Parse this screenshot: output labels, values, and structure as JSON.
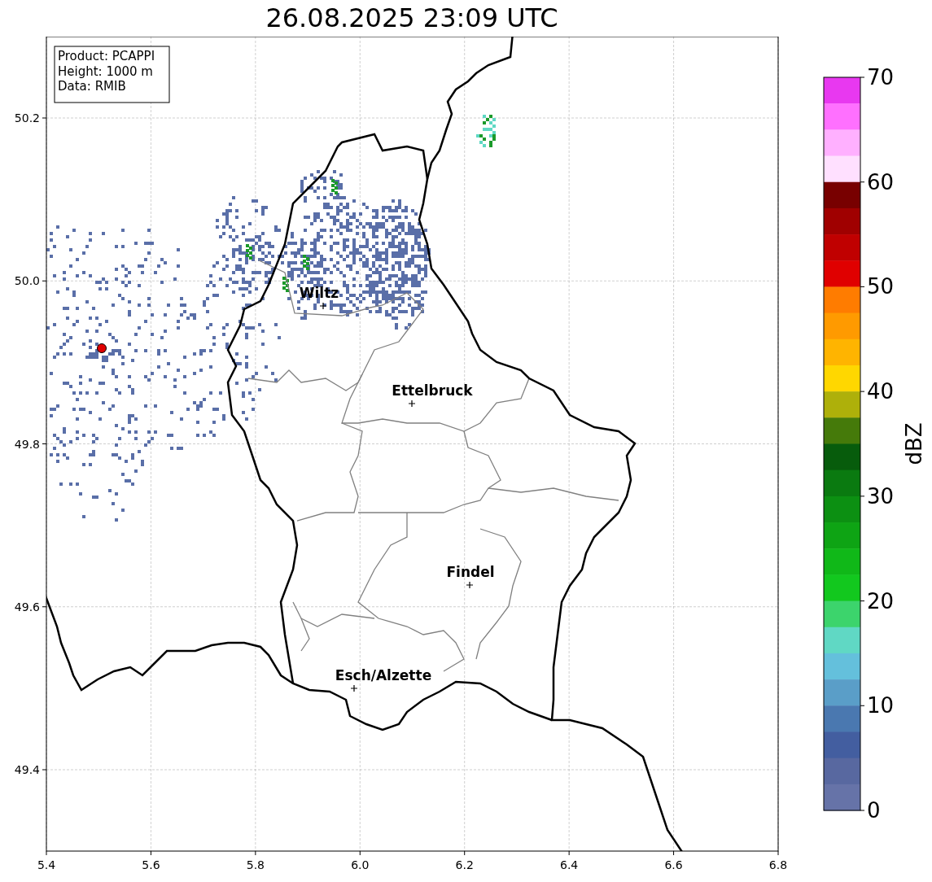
{
  "title": "26.08.2025 23:09 UTC",
  "info_box": [
    "Product: PCAPPI",
    "Height: 1000 m",
    "Data: RMIB"
  ],
  "map": {
    "x_ticks": [
      "5.4",
      "5.6",
      "5.8",
      "6.0",
      "6.2",
      "6.4",
      "6.6",
      "6.8"
    ],
    "y_ticks": [
      "50.2",
      "50.0",
      "49.8",
      "49.6",
      "49.4"
    ],
    "cities": [
      {
        "name": "Wiltz"
      },
      {
        "name": "Ettelbruck"
      },
      {
        "name": "Findel"
      },
      {
        "name": "Esch/Alzette"
      }
    ]
  },
  "colorbar": {
    "label": "dBZ",
    "ticks": [
      "70",
      "60",
      "50",
      "40",
      "30",
      "20",
      "10",
      "0"
    ],
    "segments": [
      {
        "color": "#e838f0"
      },
      {
        "color": "#ff70ff"
      },
      {
        "color": "#ffb0ff"
      },
      {
        "color": "#ffe0ff"
      },
      {
        "color": "#780000"
      },
      {
        "color": "#a00000"
      },
      {
        "color": "#c00000"
      },
      {
        "color": "#e00000"
      },
      {
        "color": "#ff7c00"
      },
      {
        "color": "#ff9a00"
      },
      {
        "color": "#ffb400"
      },
      {
        "color": "#ffd700"
      },
      {
        "color": "#aeb00a"
      },
      {
        "color": "#457a0a"
      },
      {
        "color": "#075c0c"
      },
      {
        "color": "#0a7a10"
      },
      {
        "color": "#0c9012"
      },
      {
        "color": "#0ea414"
      },
      {
        "color": "#10b818"
      },
      {
        "color": "#12c81e"
      },
      {
        "color": "#3cd46c"
      },
      {
        "color": "#60d8c4"
      },
      {
        "color": "#64c0dc"
      },
      {
        "color": "#5a9ec8"
      },
      {
        "color": "#4a78b0"
      },
      {
        "color": "#435ea0"
      },
      {
        "color": "#5868a0"
      },
      {
        "color": "#6673a8"
      }
    ]
  }
}
